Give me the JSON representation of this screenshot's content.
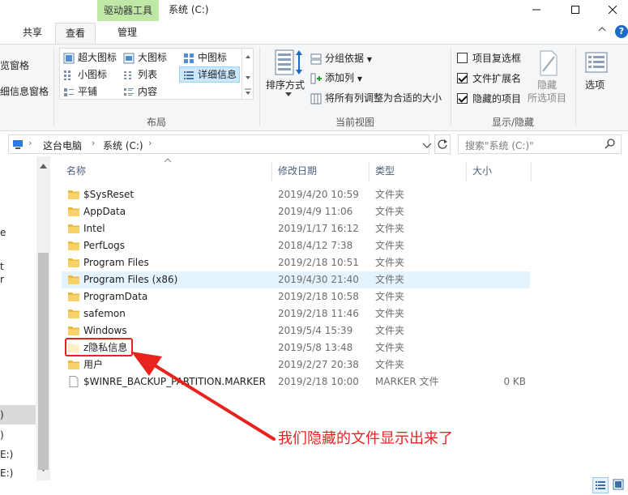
{
  "titlebar": {
    "tools_tab": "驱动器工具",
    "title": "系统 (C:)",
    "minimize": "─",
    "maximize": "☐",
    "close": "✕"
  },
  "ribbon_tabs": {
    "share": "共享",
    "view": "查看",
    "manage": "管理"
  },
  "ribbon": {
    "pane": {
      "preview": "览窗格",
      "details": "细信息窗格"
    },
    "layout": {
      "extra_large": "超大图标",
      "large": "大图标",
      "medium": "中图标",
      "small": "小图标",
      "list": "列表",
      "details": "详细信息",
      "tiles": "平铺",
      "content": "内容",
      "group_label": "布局"
    },
    "current_view": {
      "sort_by": "排序方式",
      "group_by": "分组依据",
      "add_column": "添加列",
      "fit_columns": "将所有列调整为合适的大小",
      "group_label": "当前视图"
    },
    "show_hide": {
      "item_checkboxes": "项目复选框",
      "file_extensions": "文件扩展名",
      "hidden_items": "隐藏的项目",
      "hide_selected_1": "隐藏",
      "hide_selected_2": "所选项目",
      "group_label": "显示/隐藏",
      "item_checkboxes_checked": false,
      "file_extensions_checked": true,
      "hidden_items_checked": true
    },
    "options": "选项"
  },
  "address": {
    "crumbs": [
      "这台电脑",
      "系统 (C:)"
    ],
    "separator": "›",
    "search_placeholder": "搜索\"系统 (C:)\""
  },
  "nav": {
    "items": [
      "e",
      "t",
      "r",
      ")",
      "E:)",
      "E:)"
    ]
  },
  "columns": {
    "name": "名称",
    "date": "修改日期",
    "type": "类型",
    "size": "大小"
  },
  "files": [
    {
      "name": "$SysReset",
      "date": "2019/4/20 10:59",
      "type": "文件夹",
      "size": "",
      "kind": "folder"
    },
    {
      "name": "AppData",
      "date": "2019/4/9 11:06",
      "type": "文件夹",
      "size": "",
      "kind": "folder"
    },
    {
      "name": "Intel",
      "date": "2019/1/17 16:12",
      "type": "文件夹",
      "size": "",
      "kind": "folder"
    },
    {
      "name": "PerfLogs",
      "date": "2018/4/12 7:38",
      "type": "文件夹",
      "size": "",
      "kind": "folder"
    },
    {
      "name": "Program Files",
      "date": "2019/2/18 10:51",
      "type": "文件夹",
      "size": "",
      "kind": "folder"
    },
    {
      "name": "Program Files (x86)",
      "date": "2019/4/30 21:40",
      "type": "文件夹",
      "size": "",
      "kind": "folder"
    },
    {
      "name": "ProgramData",
      "date": "2019/2/18 10:58",
      "type": "文件夹",
      "size": "",
      "kind": "folder"
    },
    {
      "name": "safemon",
      "date": "2019/2/18 11:46",
      "type": "文件夹",
      "size": "",
      "kind": "folder"
    },
    {
      "name": "Windows",
      "date": "2019/5/4 15:39",
      "type": "文件夹",
      "size": "",
      "kind": "folder"
    },
    {
      "name": "z隐私信息",
      "date": "2019/5/8 13:48",
      "type": "文件夹",
      "size": "",
      "kind": "folder-hidden"
    },
    {
      "name": "用户",
      "date": "2019/2/27 20:38",
      "type": "文件夹",
      "size": "",
      "kind": "folder"
    },
    {
      "name": "$WINRE_BACKUP_PARTITION.MARKER",
      "date": "2019/2/18 10:00",
      "type": "MARKER 文件",
      "size": "0 KB",
      "kind": "file"
    }
  ],
  "selected_row": 5,
  "annotation": {
    "text": "我们隐藏的文件显示出来了",
    "color": "#e8231f"
  },
  "colors": {
    "tools_tab": "#bfe8a7",
    "selection": "#e5f3ff",
    "accent": "#1c6bc7"
  }
}
